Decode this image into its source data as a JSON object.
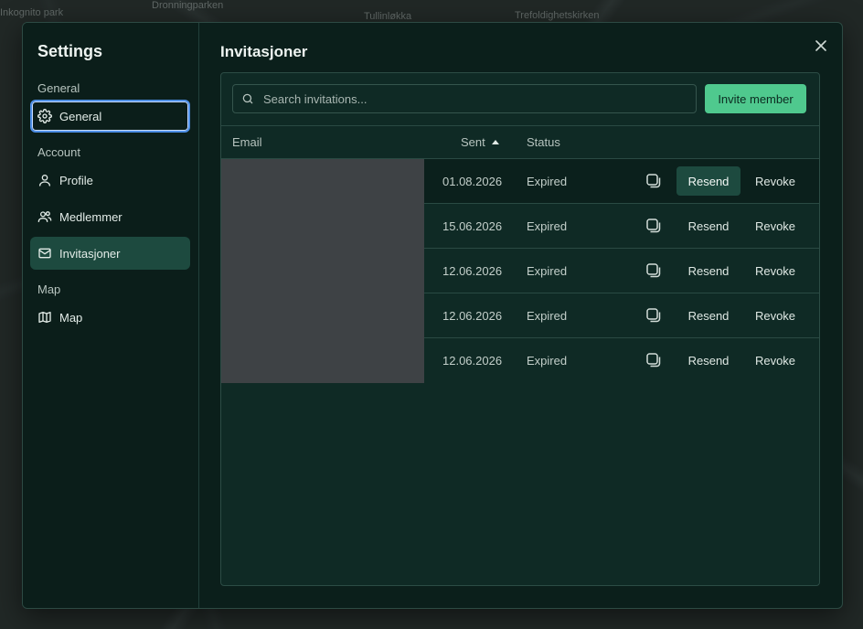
{
  "map_labels": [
    "Inkognito park",
    "Dronningparken",
    "Tullinløkka",
    "Trefoldighetskirken"
  ],
  "sidebar": {
    "title": "Settings",
    "sections": [
      {
        "label": "General",
        "items": [
          {
            "label": "General",
            "icon": "gear-icon"
          }
        ]
      },
      {
        "label": "Account",
        "items": [
          {
            "label": "Profile",
            "icon": "user-icon"
          },
          {
            "label": "Medlemmer",
            "icon": "users-icon"
          },
          {
            "label": "Invitasjoner",
            "icon": "mail-icon"
          }
        ]
      },
      {
        "label": "Map",
        "items": [
          {
            "label": "Map",
            "icon": "map-icon"
          }
        ]
      }
    ]
  },
  "main": {
    "title": "Invitasjoner",
    "search": {
      "placeholder": "Search invitations...",
      "value": ""
    },
    "invite_label": "Invite member",
    "columns": {
      "email": "Email",
      "sent": "Sent",
      "status": "Status",
      "sort": "ascending"
    },
    "rows": [
      {
        "email": "",
        "sent": "01.08.2026",
        "status": "Expired",
        "resend": "Resend",
        "revoke": "Revoke"
      },
      {
        "email": "",
        "sent": "15.06.2026",
        "status": "Expired",
        "resend": "Resend",
        "revoke": "Revoke"
      },
      {
        "email": "",
        "sent": "12.06.2026",
        "status": "Expired",
        "resend": "Resend",
        "revoke": "Revoke"
      },
      {
        "email": "",
        "sent": "12.06.2026",
        "status": "Expired",
        "resend": "Resend",
        "revoke": "Revoke"
      },
      {
        "email": "",
        "sent": "12.06.2026",
        "status": "Expired",
        "resend": "Resend",
        "revoke": "Revoke"
      }
    ]
  },
  "colors": {
    "accent": "#4fc98e",
    "active_nav": "#1d4a3f",
    "dialog_bg": "#0b1f1b",
    "focus_ring": "#4d8fe6"
  }
}
